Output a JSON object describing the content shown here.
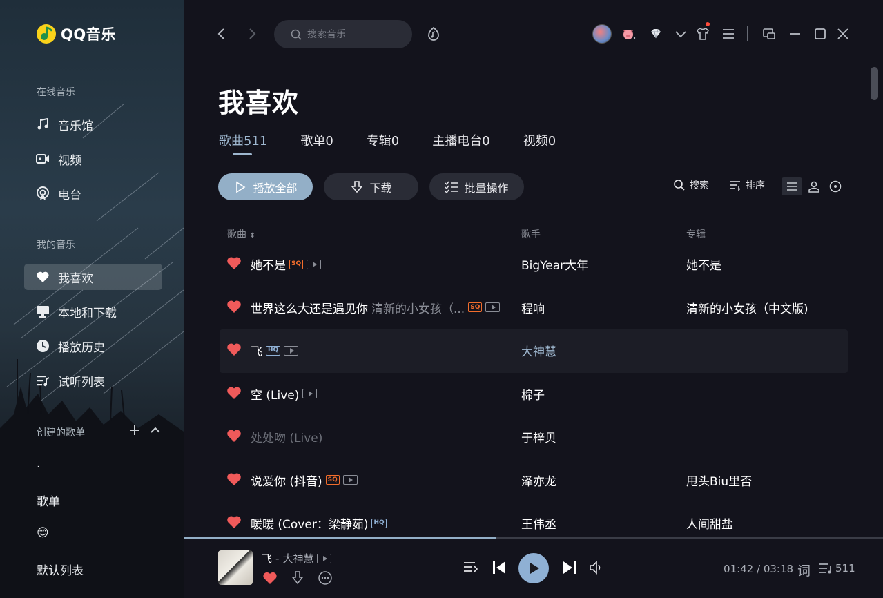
{
  "app": {
    "brand_name": "QQ音乐"
  },
  "sidebar": {
    "online_section": "在线音乐",
    "online_items": [
      {
        "label": "音乐馆",
        "icon": "music-note-icon"
      },
      {
        "label": "视频",
        "icon": "video-icon"
      },
      {
        "label": "电台",
        "icon": "radio-icon"
      }
    ],
    "my_section": "我的音乐",
    "my_items": [
      {
        "label": "我喜欢",
        "icon": "heart-icon",
        "active": true
      },
      {
        "label": "本地和下载",
        "icon": "monitor-icon"
      },
      {
        "label": "播放历史",
        "icon": "clock-icon"
      },
      {
        "label": "试听列表",
        "icon": "playlist-icon"
      }
    ],
    "created_section": "创建的歌单",
    "playlists": [
      ".",
      "歌单",
      "😊",
      "默认列表"
    ]
  },
  "topbar": {
    "search_placeholder": "搜索音乐"
  },
  "page": {
    "title": "我喜欢",
    "tabs": [
      {
        "label": "歌曲511",
        "active": true
      },
      {
        "label": "歌单0"
      },
      {
        "label": "专辑0"
      },
      {
        "label": "主播电台0"
      },
      {
        "label": "视频0"
      }
    ],
    "actions": {
      "play_all": "播放全部",
      "download": "下载",
      "batch": "批量操作"
    },
    "tools": {
      "search": "搜索",
      "sort": "排序"
    }
  },
  "table": {
    "headers": {
      "song": "歌曲",
      "artist": "歌手",
      "album": "专辑"
    },
    "rows": [
      {
        "title": "她不是",
        "sub": "",
        "badge": "SQ",
        "mv": true,
        "artist": "BigYear大年",
        "album": "她不是"
      },
      {
        "title": "世界这么大还是遇见你",
        "sub": "清新的小女孩（...",
        "badge": "SQ",
        "mv": true,
        "artist": "程响",
        "album": "清新的小女孩（中文版)"
      },
      {
        "title": "飞",
        "sub": "",
        "badge": "HQ",
        "mv": true,
        "artist": "大神慧",
        "album": "",
        "highlight": true
      },
      {
        "title": "空 (Live)",
        "sub": "",
        "badge": "",
        "mv": true,
        "artist": "棉子",
        "album": ""
      },
      {
        "title": "处处吻 (Live)",
        "sub": "",
        "badge": "",
        "mv": false,
        "artist": "于梓贝",
        "album": "",
        "dim": true
      },
      {
        "title": "说爱你 (抖音)",
        "sub": "",
        "badge": "SQ",
        "mv": true,
        "artist": "泽亦龙",
        "album": "甩头Biu里否"
      },
      {
        "title": "暖暖 (Cover：梁静茹)",
        "sub": "",
        "badge": "HQ",
        "mv": false,
        "artist": "王伟丞",
        "album": "人间甜盐"
      }
    ]
  },
  "player": {
    "song": "飞",
    "separator": "-",
    "artist": "大神慧",
    "progress": 0.446,
    "time": "01:42 / 03:18",
    "lyric_label": "词",
    "queue_count": "511"
  },
  "colors": {
    "accent": "#93afc7",
    "heart": "#f05a5a",
    "sq": "#f26d2c",
    "hq": "#8fb0d4"
  }
}
